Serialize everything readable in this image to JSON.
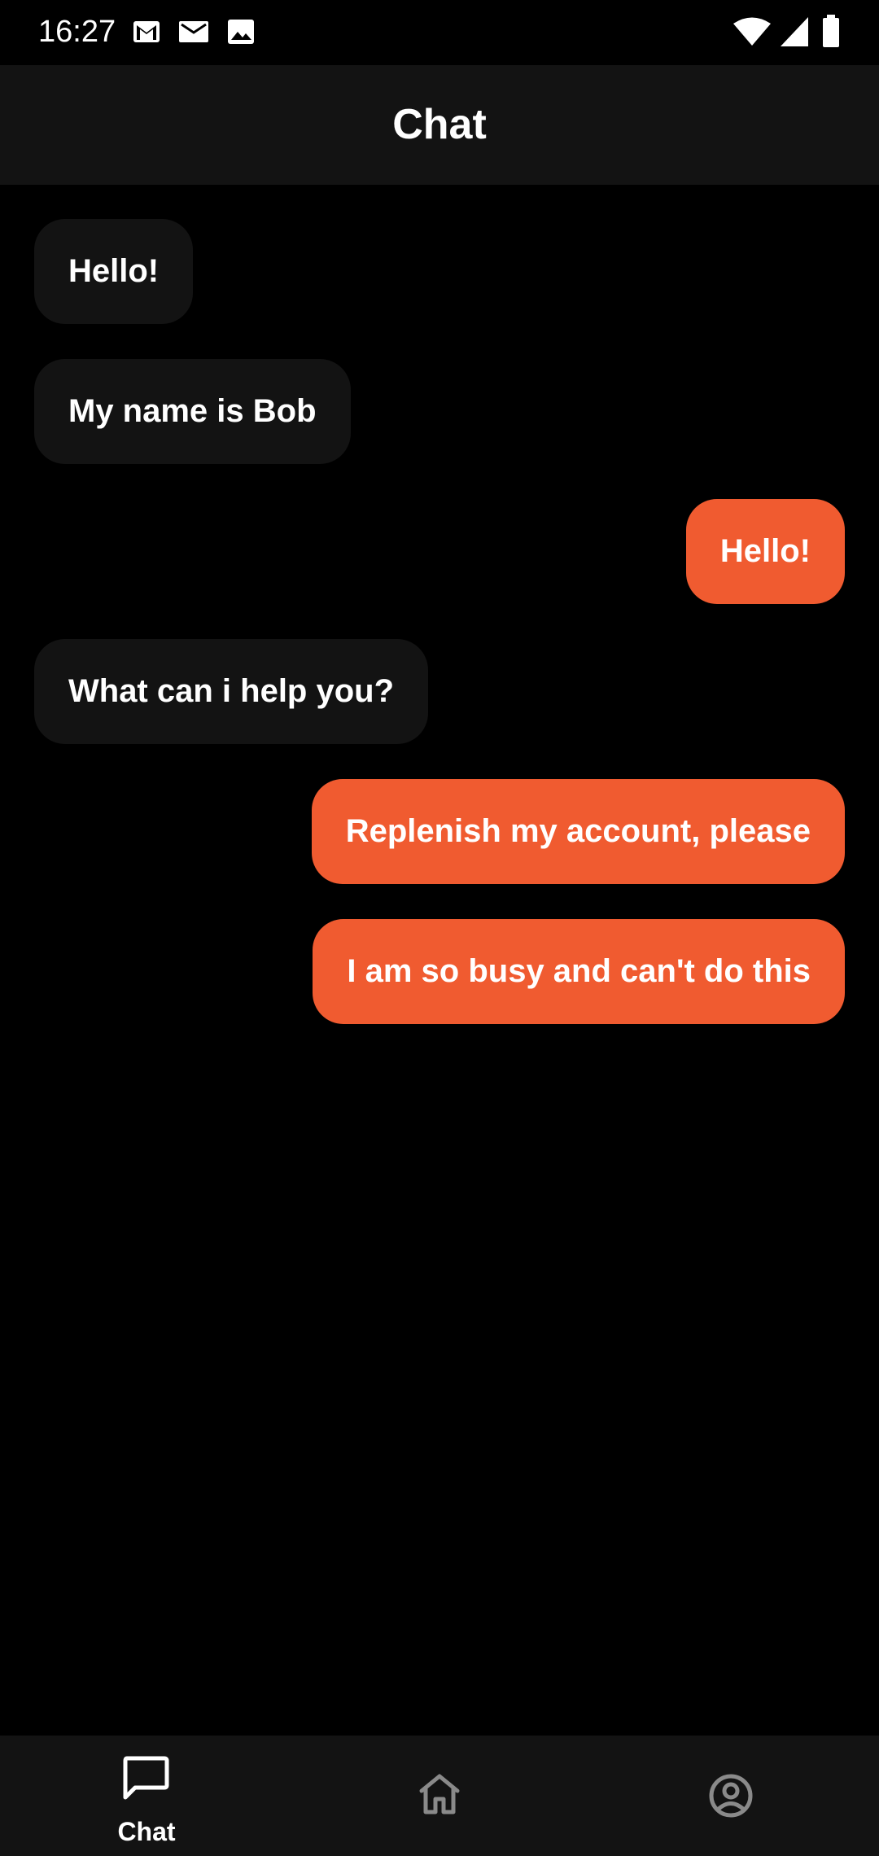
{
  "status_bar": {
    "time": "16:27",
    "notification_icons": [
      "gmail-icon",
      "mail-icon",
      "image-icon"
    ],
    "system_icons": [
      "wifi-icon",
      "signal-icon",
      "battery-icon"
    ]
  },
  "app_bar": {
    "title": "Chat"
  },
  "messages": [
    {
      "text": "Hello!",
      "direction": "incoming"
    },
    {
      "text": "My name is Bob",
      "direction": "incoming"
    },
    {
      "text": "Hello!",
      "direction": "outgoing"
    },
    {
      "text": "What can i help you?",
      "direction": "incoming"
    },
    {
      "text": "Replenish my account, please",
      "direction": "outgoing"
    },
    {
      "text": "I am so busy and can't do this",
      "direction": "outgoing"
    }
  ],
  "bottom_nav": {
    "items": [
      {
        "label": "Chat",
        "icon": "chat-icon",
        "selected": true
      },
      {
        "label": "",
        "icon": "home-icon",
        "selected": false
      },
      {
        "label": "",
        "icon": "profile-icon",
        "selected": false
      }
    ]
  },
  "colors": {
    "background": "#000000",
    "surface": "#131313",
    "accent": "#f05b30",
    "inactive_icon": "#8a8a8a",
    "text": "#ffffff"
  }
}
